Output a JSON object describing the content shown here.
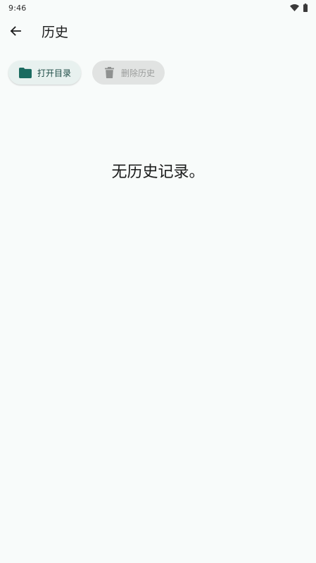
{
  "status_bar": {
    "time": "9:46",
    "icons": [
      "wifi-icon",
      "battery-icon"
    ]
  },
  "app_bar": {
    "back_icon": "arrow-left-icon",
    "title": "历史"
  },
  "actions": {
    "open_directory": {
      "label": "打开目录",
      "icon": "folder-icon",
      "enabled": true
    },
    "delete_history": {
      "label": "删除历史",
      "icon": "trash-icon",
      "enabled": false
    }
  },
  "empty_state": {
    "message": "无历史记录。"
  },
  "colors": {
    "background": "#f8fbfa",
    "primary": "#1b6b60",
    "open_chip_bg": "#e8f1ef",
    "disabled_chip_bg": "#e1e3e2",
    "disabled_text": "#9a9c9b"
  }
}
